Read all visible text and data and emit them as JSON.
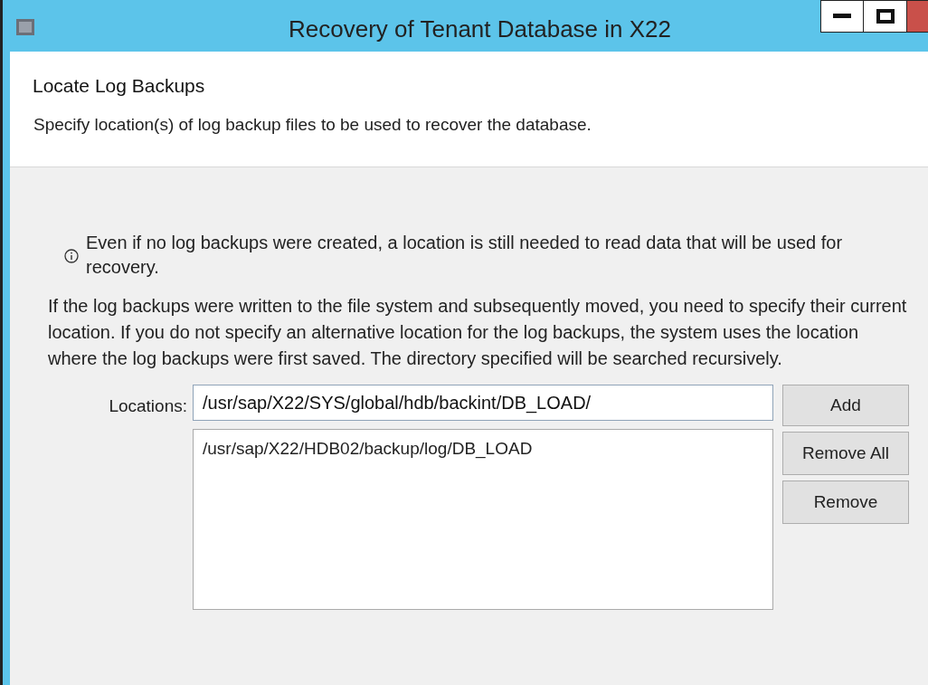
{
  "window": {
    "title": "Recovery of Tenant Database in X22",
    "controls": [
      {
        "kind": "minimize"
      },
      {
        "kind": "maximize"
      },
      {
        "kind": "close"
      }
    ]
  },
  "header": {
    "title": "Locate Log Backups",
    "subtitle": "Specify location(s) of log backup files to be used to recover the database."
  },
  "info_note": "Even if no log backups were created, a location is still needed to read data that will be used for recovery.",
  "description": "If the log backups were written to the file system and subsequently moved, you need to specify their current location. If you do not specify an alternative location for the log backups, the system uses the location where the log backups were first saved. The directory specified will be searched recursively.",
  "locations": {
    "label": "Locations:",
    "value": "/usr/sap/X22/SYS/global/hdb/backint/DB_LOAD/",
    "items": [
      "/usr/sap/X22/HDB02/backup/log/DB_LOAD"
    ]
  },
  "buttons": [
    "Add",
    "Remove All",
    "Remove"
  ]
}
